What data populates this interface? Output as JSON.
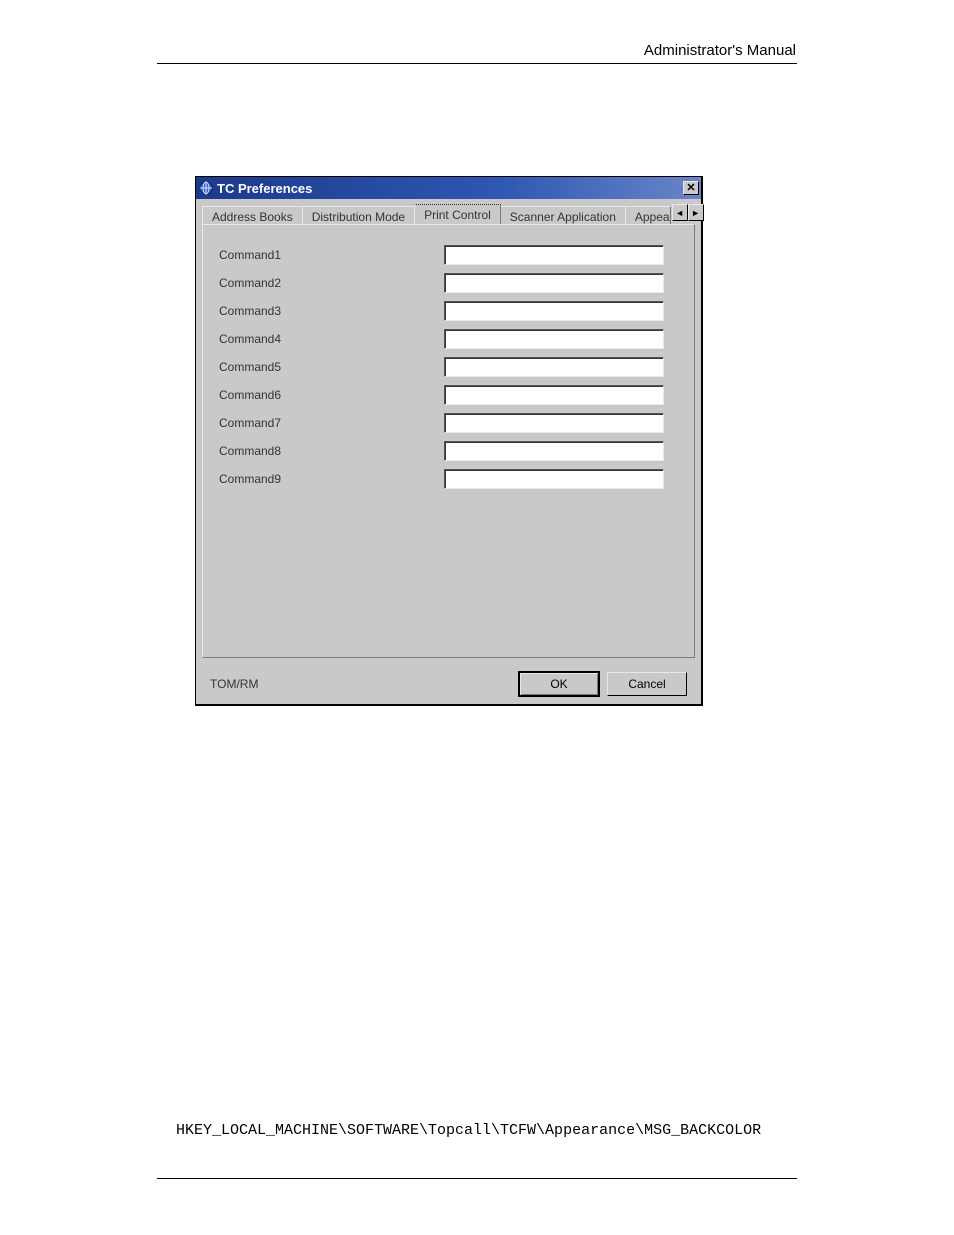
{
  "page_header": "Administrator's Manual",
  "dialog": {
    "title": "TC Preferences",
    "tabs": [
      {
        "label": "Address Books",
        "active": false
      },
      {
        "label": "Distribution Mode",
        "active": false
      },
      {
        "label": "Print Control",
        "active": true
      },
      {
        "label": "Scanner Application",
        "active": false
      },
      {
        "label": "Appea",
        "active": false,
        "truncated": true
      }
    ],
    "fields": [
      {
        "label": "Command1",
        "value": ""
      },
      {
        "label": "Command2",
        "value": ""
      },
      {
        "label": "Command3",
        "value": ""
      },
      {
        "label": "Command4",
        "value": ""
      },
      {
        "label": "Command5",
        "value": ""
      },
      {
        "label": "Command6",
        "value": ""
      },
      {
        "label": "Command7",
        "value": ""
      },
      {
        "label": "Command8",
        "value": ""
      },
      {
        "label": "Command9",
        "value": ""
      }
    ],
    "status": "TOM/RM",
    "buttons": {
      "ok": "OK",
      "cancel": "Cancel"
    }
  },
  "registry_path": "HKEY_LOCAL_MACHINE\\SOFTWARE\\Topcall\\TCFW\\Appearance\\MSG_BACKCOLOR"
}
